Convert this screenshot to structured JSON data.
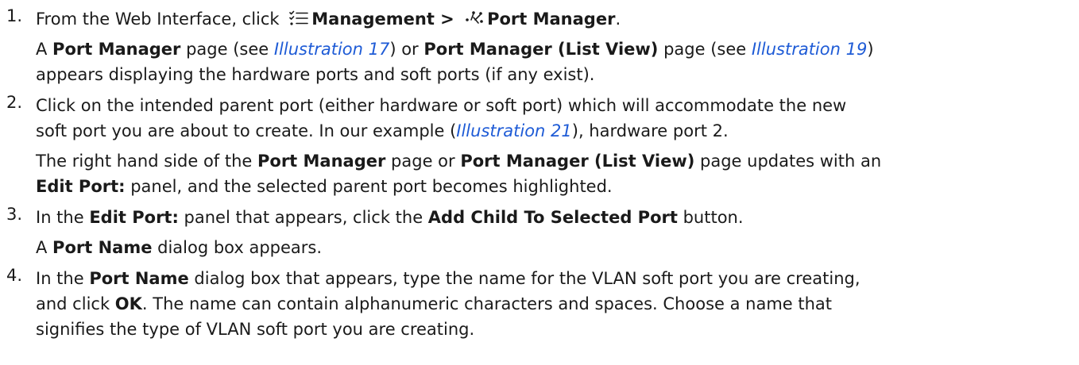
{
  "steps": [
    {
      "number": "1.",
      "l1": [
        "From the Web Interface, click ",
        "Management > ",
        "Port Manager",
        "."
      ],
      "l2": [
        "A ",
        "Port Manager",
        " page (see ",
        "Illustration 17",
        ") or ",
        "Port Manager (List View)",
        " page (see ",
        "Illustration 19",
        ")"
      ],
      "l3": "appears displaying the hardware ports and soft ports (if any exist)."
    },
    {
      "number": "2.",
      "l1": "Click on the intended parent port (either hardware or soft port) which will accommodate the new",
      "l2": [
        "soft port you are about to create. In our example (",
        "Illustration 21",
        "), hardware port 2."
      ],
      "l3": [
        "The right hand side of the ",
        "Port Manager",
        " page or ",
        "Port Manager (List View)",
        " page updates with an"
      ],
      "l4": [
        "Edit Port:",
        " panel, and the selected parent port becomes highlighted."
      ]
    },
    {
      "number": "3.",
      "l1": [
        "In the ",
        "Edit Port:",
        " panel that appears, click the ",
        "Add Child To Selected Port",
        " button."
      ],
      "l2": [
        "A ",
        "Port Name",
        " dialog box appears."
      ]
    },
    {
      "number": "4.",
      "l1": [
        "In the ",
        "Port Name",
        " dialog box that appears, type the name for the VLAN soft port you are creating,"
      ],
      "l2": [
        "and click ",
        "OK",
        ". The name can contain alphanumeric characters and spaces. Choose a name that"
      ],
      "l3": "signifies the type of VLAN soft port you are creating."
    }
  ],
  "icons": {
    "management": "list-check-icon",
    "port_manager": "port-network-icon"
  },
  "colors": {
    "text": "#1a1a1a",
    "link": "#1e5bd6"
  }
}
